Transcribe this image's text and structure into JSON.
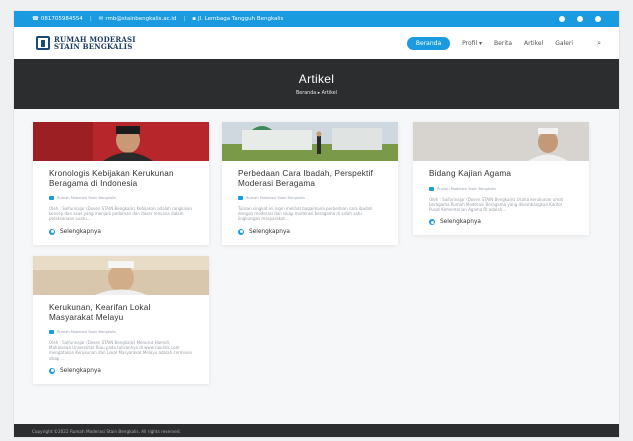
{
  "topbar": {
    "phone": "081705984554",
    "email": "rmb@stainbengkalis.ac.id",
    "address": "Jl. Lembaga Tangguh Bengkalis"
  },
  "brand": {
    "line1": "RUMAH MODERASI",
    "line2": "STAIN BENGKALIS"
  },
  "nav": {
    "items": [
      "Beranda",
      "Profil ▾",
      "Berita",
      "Artikel",
      "Galeri"
    ]
  },
  "hero": {
    "title": "Artikel",
    "breadcrumb": "Beranda ▸ Artikel"
  },
  "cards": [
    {
      "title": "Kronologis Kebijakan Kerukunan Beragama di Indonesia",
      "meta": "Rumah Moderasi Stain Bengkalis",
      "excerpt": "Oleh : Saifunnajar (Dosen STAIN Bengkalis) Kebijakan adalah rangkaian konsep dan asas yang menjadi pedoman dan dasar rencana dalam pelaksanaan suatu...",
      "more": "Selengkapnya"
    },
    {
      "title": "Perbedaan Cara Ibadah, Perspektif Moderasi Beragama",
      "meta": "Rumah Moderasi Stain Bengkalis",
      "excerpt": "Tulisan singkat ini ingin melihat bagaimana perbedaan cara ibadah dengan moderasi dan sikap moderasi beragama di salah satu lingkungan masyarakat...",
      "more": "Selengkapnya"
    },
    {
      "title": "Bidang Kajian Agama",
      "meta": "Rumah Moderasi Stain Bengkalis",
      "excerpt": "Oleh : Saifunnajar (Dosen STAIN Bengkalis) Usaha kerukunan umat beragama Rumah Moderasi Beragama yang dikembangkan Kantor Pusat Kementerian Agama RI adalah...",
      "more": "Selengkapnya"
    },
    {
      "title": "Kerukunan, Kearifan Lokal Masyarakat Melayu",
      "meta": "Rumah Moderasi Stain Bengkalis",
      "excerpt": "Oleh : Saifunnajar (Dosen STAIN Bengkalis) Menurut Hamidi, Mahasiswa Universitas Riau pada tulisannya di www.riaulink.com mengatakan Kerukunan dan Lokal Masyarakat Melayu adalah cerminan sikap ...",
      "more": "Selengkapnya"
    }
  ],
  "footer": {
    "copyright": "Copyright ©2022 Rumah Moderasi Stain Bengkalis. All rights reserved."
  }
}
